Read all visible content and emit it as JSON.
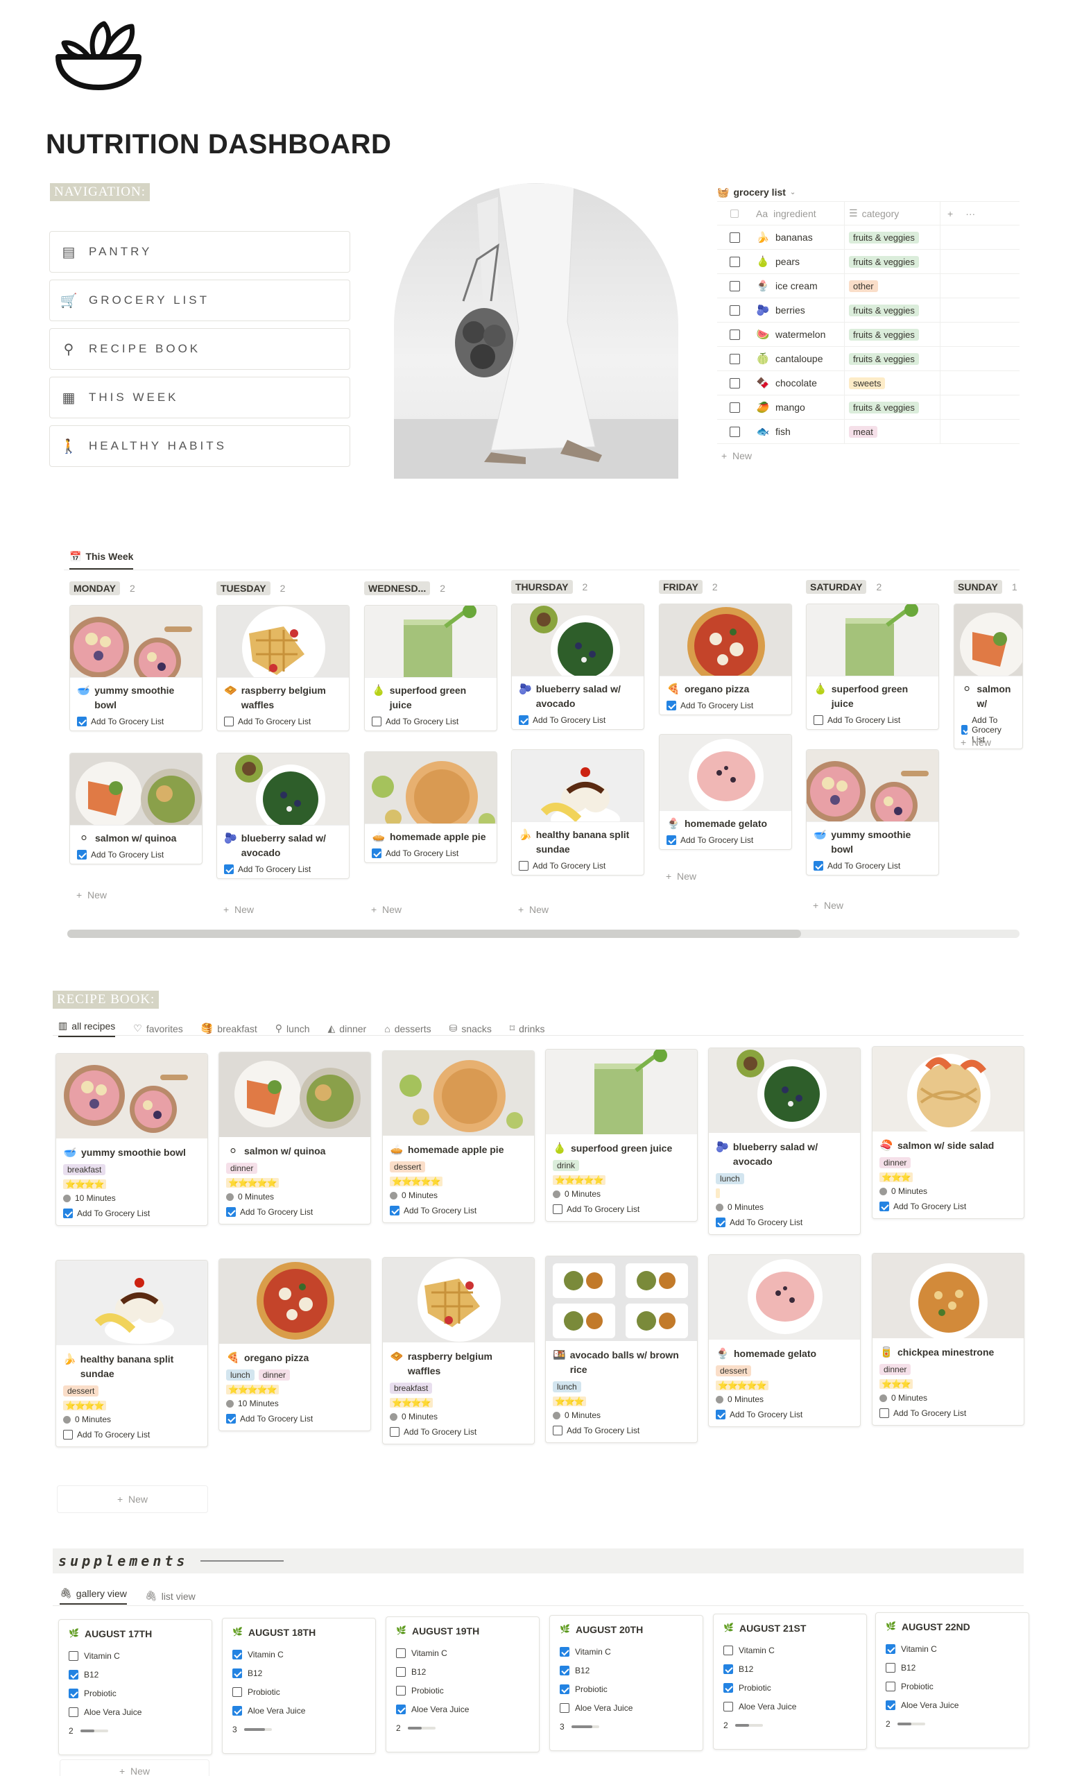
{
  "title": "NUTRITION DASHBOARD",
  "navigation": {
    "label": "NAVIGATION:",
    "items": [
      {
        "label": "PANTRY",
        "icon": "pantry-icon"
      },
      {
        "label": "GROCERY LIST",
        "icon": "cart-icon"
      },
      {
        "label": "RECIPE BOOK",
        "icon": "whisk-icon"
      },
      {
        "label": "THIS WEEK",
        "icon": "calendar-icon"
      },
      {
        "label": "HEALTHY HABITS",
        "icon": "walk-icon"
      }
    ]
  },
  "grocery": {
    "title": "grocery list",
    "col_ingredient": "ingredient",
    "col_category": "category",
    "new": "New",
    "rows": [
      {
        "name": "bananas",
        "emoji": "🍌",
        "category": "fruits & veggies",
        "color": "green"
      },
      {
        "name": "pears",
        "emoji": "🍐",
        "category": "fruits & veggies",
        "color": "green"
      },
      {
        "name": "ice cream",
        "emoji": "🍨",
        "category": "other",
        "color": "orange"
      },
      {
        "name": "berries",
        "emoji": "🫐",
        "category": "fruits & veggies",
        "color": "green"
      },
      {
        "name": "watermelon",
        "emoji": "🍉",
        "category": "fruits & veggies",
        "color": "green"
      },
      {
        "name": "cantaloupe",
        "emoji": "🍈",
        "category": "fruits & veggies",
        "color": "green"
      },
      {
        "name": "chocolate",
        "emoji": "🍫",
        "category": "sweets",
        "color": "yellow"
      },
      {
        "name": "mango",
        "emoji": "🥭",
        "category": "fruits & veggies",
        "color": "green"
      },
      {
        "name": "fish",
        "emoji": "🐟",
        "category": "meat",
        "color": "pink"
      }
    ]
  },
  "week": {
    "title": "This Week",
    "add_label": "Add To Grocery List",
    "new": "New",
    "days": [
      {
        "name": "MONDAY",
        "count": "2",
        "cards": [
          {
            "name": "yummy smoothie bowl",
            "emoji": "🥣",
            "checked": true,
            "img": "bowl"
          },
          {
            "name": "salmon w/ quinoa",
            "emoji": "⚪",
            "checked": true,
            "img": "salmon"
          }
        ]
      },
      {
        "name": "TUESDAY",
        "count": "2",
        "cards": [
          {
            "name": "raspberry belgium waffles",
            "emoji": "🧇",
            "checked": false,
            "img": "waffle"
          },
          {
            "name": "blueberry salad w/ avocado",
            "emoji": "🫐",
            "checked": true,
            "img": "salad"
          }
        ]
      },
      {
        "name": "WEDNESD...",
        "count": "2",
        "cards": [
          {
            "name": "superfood green juice",
            "emoji": "🍐",
            "checked": false,
            "img": "juice"
          },
          {
            "name": "homemade apple pie",
            "emoji": "🥧",
            "checked": true,
            "img": "pie"
          }
        ]
      },
      {
        "name": "THURSDAY",
        "count": "2",
        "cards": [
          {
            "name": "blueberry salad w/ avocado",
            "emoji": "🫐",
            "checked": true,
            "img": "salad"
          },
          {
            "name": "healthy banana split sundae",
            "emoji": "🍌",
            "checked": false,
            "img": "sundae"
          }
        ]
      },
      {
        "name": "FRIDAY",
        "count": "2",
        "cards": [
          {
            "name": "oregano pizza",
            "emoji": "🍕",
            "checked": true,
            "img": "pizza"
          },
          {
            "name": "homemade gelato",
            "emoji": "🍨",
            "checked": true,
            "img": "gelato"
          }
        ]
      },
      {
        "name": "SATURDAY",
        "count": "2",
        "cards": [
          {
            "name": "superfood green juice",
            "emoji": "🍐",
            "checked": false,
            "img": "juice"
          },
          {
            "name": "yummy smoothie bowl",
            "emoji": "🥣",
            "checked": true,
            "img": "bowl"
          }
        ]
      },
      {
        "name": "SUNDAY",
        "count": "1",
        "cards": [
          {
            "name": "salmon w/",
            "emoji": "⚪",
            "checked": true,
            "img": "salmon"
          }
        ]
      }
    ]
  },
  "recipe_book": {
    "label": "RECIPE BOOK:",
    "new": "New",
    "add_label": "Add To Grocery List",
    "tabs": [
      {
        "label": "all recipes",
        "icon": "gallery-icon"
      },
      {
        "label": "favorites",
        "icon": "heart-icon"
      },
      {
        "label": "breakfast",
        "icon": "breakfast-icon"
      },
      {
        "label": "lunch",
        "icon": "lunch-icon"
      },
      {
        "label": "dinner",
        "icon": "dinner-icon"
      },
      {
        "label": "desserts",
        "icon": "cake-icon"
      },
      {
        "label": "snacks",
        "icon": "snack-icon"
      },
      {
        "label": "drinks",
        "icon": "drink-icon"
      }
    ],
    "recipes": [
      {
        "name": "yummy smoothie bowl",
        "emoji": "🥣",
        "tags": [
          {
            "t": "breakfast",
            "c": "purple"
          }
        ],
        "stars": "⭐⭐⭐⭐",
        "minutes": "10 Minutes",
        "checked": true,
        "img": "bowl"
      },
      {
        "name": "salmon w/ quinoa",
        "emoji": "⚪",
        "tags": [
          {
            "t": "dinner",
            "c": "pink"
          }
        ],
        "stars": "⭐⭐⭐⭐⭐",
        "minutes": "0 Minutes",
        "checked": true,
        "img": "salmon"
      },
      {
        "name": "homemade apple pie",
        "emoji": "🥧",
        "tags": [
          {
            "t": "dessert",
            "c": "orange"
          }
        ],
        "stars": "⭐⭐⭐⭐⭐",
        "minutes": "0 Minutes",
        "checked": true,
        "img": "pie"
      },
      {
        "name": "superfood green juice",
        "emoji": "🍐",
        "tags": [
          {
            "t": "drink",
            "c": "green"
          }
        ],
        "stars": "⭐⭐⭐⭐⭐",
        "minutes": "0 Minutes",
        "checked": false,
        "img": "juice"
      },
      {
        "name": "blueberry salad w/ avocado",
        "emoji": "🫐",
        "tags": [
          {
            "t": "lunch",
            "c": "blue"
          }
        ],
        "stars": "",
        "minutes": "0 Minutes",
        "checked": true,
        "img": "salad"
      },
      {
        "name": "salmon w/ side salad",
        "emoji": "🍣",
        "tags": [
          {
            "t": "dinner",
            "c": "pink"
          }
        ],
        "stars": "⭐⭐⭐",
        "minutes": "0 Minutes",
        "checked": true,
        "img": "pasta"
      },
      {
        "name": "healthy banana split sundae",
        "emoji": "🍌",
        "tags": [
          {
            "t": "dessert",
            "c": "orange"
          }
        ],
        "stars": "⭐⭐⭐⭐",
        "minutes": "0 Minutes",
        "checked": false,
        "img": "sundae"
      },
      {
        "name": "oregano pizza",
        "emoji": "🍕",
        "tags": [
          {
            "t": "lunch",
            "c": "blue"
          },
          {
            "t": "dinner",
            "c": "pink"
          }
        ],
        "stars": "⭐⭐⭐⭐⭐",
        "minutes": "10 Minutes",
        "checked": true,
        "img": "pizza"
      },
      {
        "name": "raspberry belgium waffles",
        "emoji": "🧇",
        "tags": [
          {
            "t": "breakfast",
            "c": "purple"
          }
        ],
        "stars": "⭐⭐⭐⭐",
        "minutes": "0 Minutes",
        "checked": false,
        "img": "waffle"
      },
      {
        "name": "avocado balls w/ brown rice",
        "emoji": "🍱",
        "tags": [
          {
            "t": "lunch",
            "c": "blue"
          }
        ],
        "stars": "⭐⭐⭐",
        "minutes": "0 Minutes",
        "checked": false,
        "img": "balls"
      },
      {
        "name": "homemade gelato",
        "emoji": "🍨",
        "tags": [
          {
            "t": "dessert",
            "c": "orange"
          }
        ],
        "stars": "⭐⭐⭐⭐⭐",
        "minutes": "0 Minutes",
        "checked": true,
        "img": "gelato"
      },
      {
        "name": "chickpea minestrone",
        "emoji": "🥫",
        "tags": [
          {
            "t": "dinner",
            "c": "pink"
          }
        ],
        "stars": "⭐⭐⭐",
        "minutes": "0 Minutes",
        "checked": false,
        "img": "chickpea"
      }
    ]
  },
  "supplements": {
    "title": "supplements",
    "tab_gallery": "gallery view",
    "tab_list": "list view",
    "new": "New",
    "items": [
      "Vitamin C",
      "B12",
      "Probiotic",
      "Aloe Vera Juice"
    ],
    "days": [
      {
        "date": "AUGUST 17TH",
        "checks": [
          false,
          true,
          true,
          false
        ],
        "count": "2",
        "progress": 0.5
      },
      {
        "date": "AUGUST 18TH",
        "checks": [
          true,
          true,
          false,
          true
        ],
        "count": "3",
        "progress": 0.75
      },
      {
        "date": "AUGUST 19TH",
        "checks": [
          false,
          false,
          false,
          true
        ],
        "count": "2",
        "progress": 0.5
      },
      {
        "date": "AUGUST 20TH",
        "checks": [
          true,
          true,
          true,
          false
        ],
        "count": "3",
        "progress": 0.75
      },
      {
        "date": "AUGUST 21ST",
        "checks": [
          false,
          true,
          true,
          false
        ],
        "count": "2",
        "progress": 0.5
      },
      {
        "date": "AUGUST 22ND",
        "checks": [
          true,
          false,
          false,
          true
        ],
        "count": "2",
        "progress": 0.5
      }
    ]
  }
}
